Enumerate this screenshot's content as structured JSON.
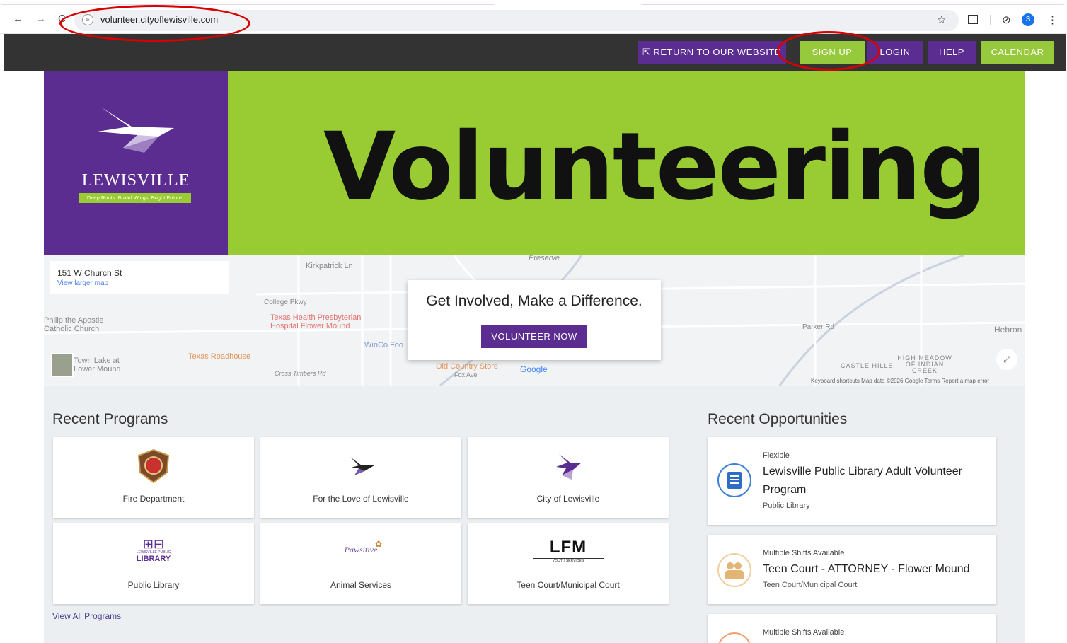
{
  "browser": {
    "url": "volunteer.cityoflewisville.com",
    "back_icon": "←",
    "forward_icon": "→",
    "reload_icon": "C",
    "star_icon": "☆",
    "profile_letter": "S",
    "menu_icon": "⋮"
  },
  "topnav": {
    "return_label": "RETURN TO OUR WEBSITE",
    "signup_label": "SIGN UP",
    "login_label": "LOGIN",
    "help_label": "HELP",
    "calendar_label": "CALENDAR"
  },
  "banner": {
    "logo_name": "LEWISVILLE",
    "logo_tagline": "Deep Roots. Broad Wings. Bright Future.",
    "title": "Volunteering"
  },
  "map": {
    "address": "151 W Church St",
    "view_larger": "View larger map",
    "labels": {
      "kirkpatrick": "Kirkpatrick Ln",
      "college": "College Pkwy",
      "hospital": "Texas Health Presbyterian Hospital Flower Mound",
      "church": "Philip the Apostle Catholic Church",
      "roadhouse": "Texas Roadhouse",
      "winco": "WinCo Foo",
      "oldcountry": "Old Country Store",
      "foxave": "Fox Ave",
      "town": "Town Lake at Lower Mound",
      "parker": "Parker Rd",
      "hebron": "Hebron",
      "castle": "CASTLE HILLS",
      "highmeadow": "HIGH MEADOW OF INDIAN CREEK",
      "crosstimbers": "Cross Timbers Rd",
      "preserve": "Preserve",
      "google": "Google",
      "footer": "Keyboard shortcuts   Map data ©2026 Google   Terms   Report a map error"
    }
  },
  "cta": {
    "title": "Get Involved, Make a Difference.",
    "button": "VOLUNTEER NOW"
  },
  "programs": {
    "heading": "Recent Programs",
    "items": [
      {
        "label": "Fire Department"
      },
      {
        "label": "For the Love of Lewisville"
      },
      {
        "label": "City of Lewisville"
      },
      {
        "label": "Public Library"
      },
      {
        "label": "Animal Services"
      },
      {
        "label": "Teen Court/Municipal Court"
      }
    ],
    "view_all": "View All Programs",
    "library_logo_small": "LEWISVILLE PUBLIC",
    "library_logo_big": "LIBRARY",
    "lfm_logo": "LFM",
    "lfm_sub": "YOUTH SERVICES",
    "paws_logo": "Pawsitive"
  },
  "opportunities": {
    "heading": "Recent Opportunities",
    "items": [
      {
        "kind": "Flexible",
        "title": "Lewisville Public Library Adult Volunteer Program",
        "org": "Public Library"
      },
      {
        "kind": "Multiple Shifts Available",
        "title": "Teen Court - ATTORNEY - Flower Mound",
        "org": "Teen Court/Municipal Court"
      },
      {
        "kind": "Multiple Shifts Available",
        "title": "",
        "org": ""
      }
    ]
  },
  "colors": {
    "purple": "#5c2d91",
    "green": "#97c93d",
    "nav_dark": "#333333",
    "annotation_red": "#d90000"
  }
}
